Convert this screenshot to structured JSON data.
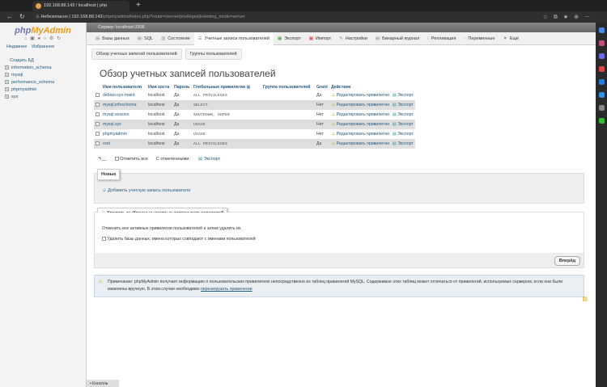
{
  "browser": {
    "tab_title": "192.168.88.143 / localhost | php",
    "security": "Небезопасно",
    "url_host": "192.168.88.143",
    "url_path": "/phpmyadmin/index.php?route=/server/privileges&viewing_mode=server"
  },
  "nav": {
    "logo_php": "php",
    "logo_my": "MyAdmin",
    "recent": "Недавнее",
    "favorites": "Избранное",
    "new_db": "Создать БД",
    "databases": [
      "information_schema",
      "mysql",
      "performance_schema",
      "phpmyadmin",
      "sys"
    ]
  },
  "server_bar": "Сервер: localhost:3306",
  "menu": [
    "Базы данных",
    "SQL",
    "Состояние",
    "Учетные записи пользователей",
    "Экспорт",
    "Импорт",
    "Настройки",
    "Бинарный журнал",
    "Репликация",
    "Переменные",
    "Ещё"
  ],
  "subtabs": [
    "Обзор учетных записей пользователей",
    "Группы пользователей"
  ],
  "title": "Обзор учетных записей пользователей",
  "table": {
    "headers": [
      "Имя пользователя",
      "Имя хоста",
      "Пароль",
      "Глобальные привилегии",
      "Группа пользователей",
      "Grant",
      "Действие"
    ],
    "edit_label": "Редактировать привилегии",
    "export_label": "Экспорт",
    "rows": [
      {
        "user": "debian-sys-maint",
        "host": "localhost",
        "password": "Да",
        "privileges": "ALL PRIVILEGES",
        "group": "",
        "grant": "Да"
      },
      {
        "user": "mysql.infoschema",
        "host": "localhost",
        "password": "Да",
        "privileges": "SELECT",
        "group": "",
        "grant": "Нет"
      },
      {
        "user": "mysql.session",
        "host": "localhost",
        "password": "Да",
        "privileges": "SHUTDOWN, SUPER",
        "group": "",
        "grant": "Нет"
      },
      {
        "user": "mysql.sys",
        "host": "localhost",
        "password": "Да",
        "privileges": "USAGE",
        "group": "",
        "grant": "Нет"
      },
      {
        "user": "phpmyadmin",
        "host": "localhost",
        "password": "Да",
        "privileges": "USAGE",
        "group": "",
        "grant": "Нет"
      },
      {
        "user": "root",
        "host": "localhost",
        "password": "Да",
        "privileges": "ALL PRIVILEGES",
        "group": "",
        "grant": "Да"
      }
    ]
  },
  "footer": {
    "check_all": "Отметить все",
    "with_selected": "С отмеченными:",
    "export": "Экспорт"
  },
  "new_section": {
    "legend": "Новые",
    "add_user": "Добавить учетную запись пользователя"
  },
  "delete_section": {
    "legend": "Удалить выбранные учетные записи пользователей",
    "desc": "Отменить все активные привилегии пользователей и затем удалить их.",
    "drop_db": "Удалить базы данных, имена которых совпадают с именами пользователей",
    "go": "Вперёд"
  },
  "note": {
    "text": "Примечание: phpMyAdmin получает информацию о пользовательских привилегиях непосредственно из таблиц привилегий MySQL. Содержимое этих таблиц может отличаться от привилегий, используемых сервером, если они были изменены вручную. В этом случае необходимо",
    "link": "перезагрузить привилегии"
  },
  "console": "Консоль"
}
